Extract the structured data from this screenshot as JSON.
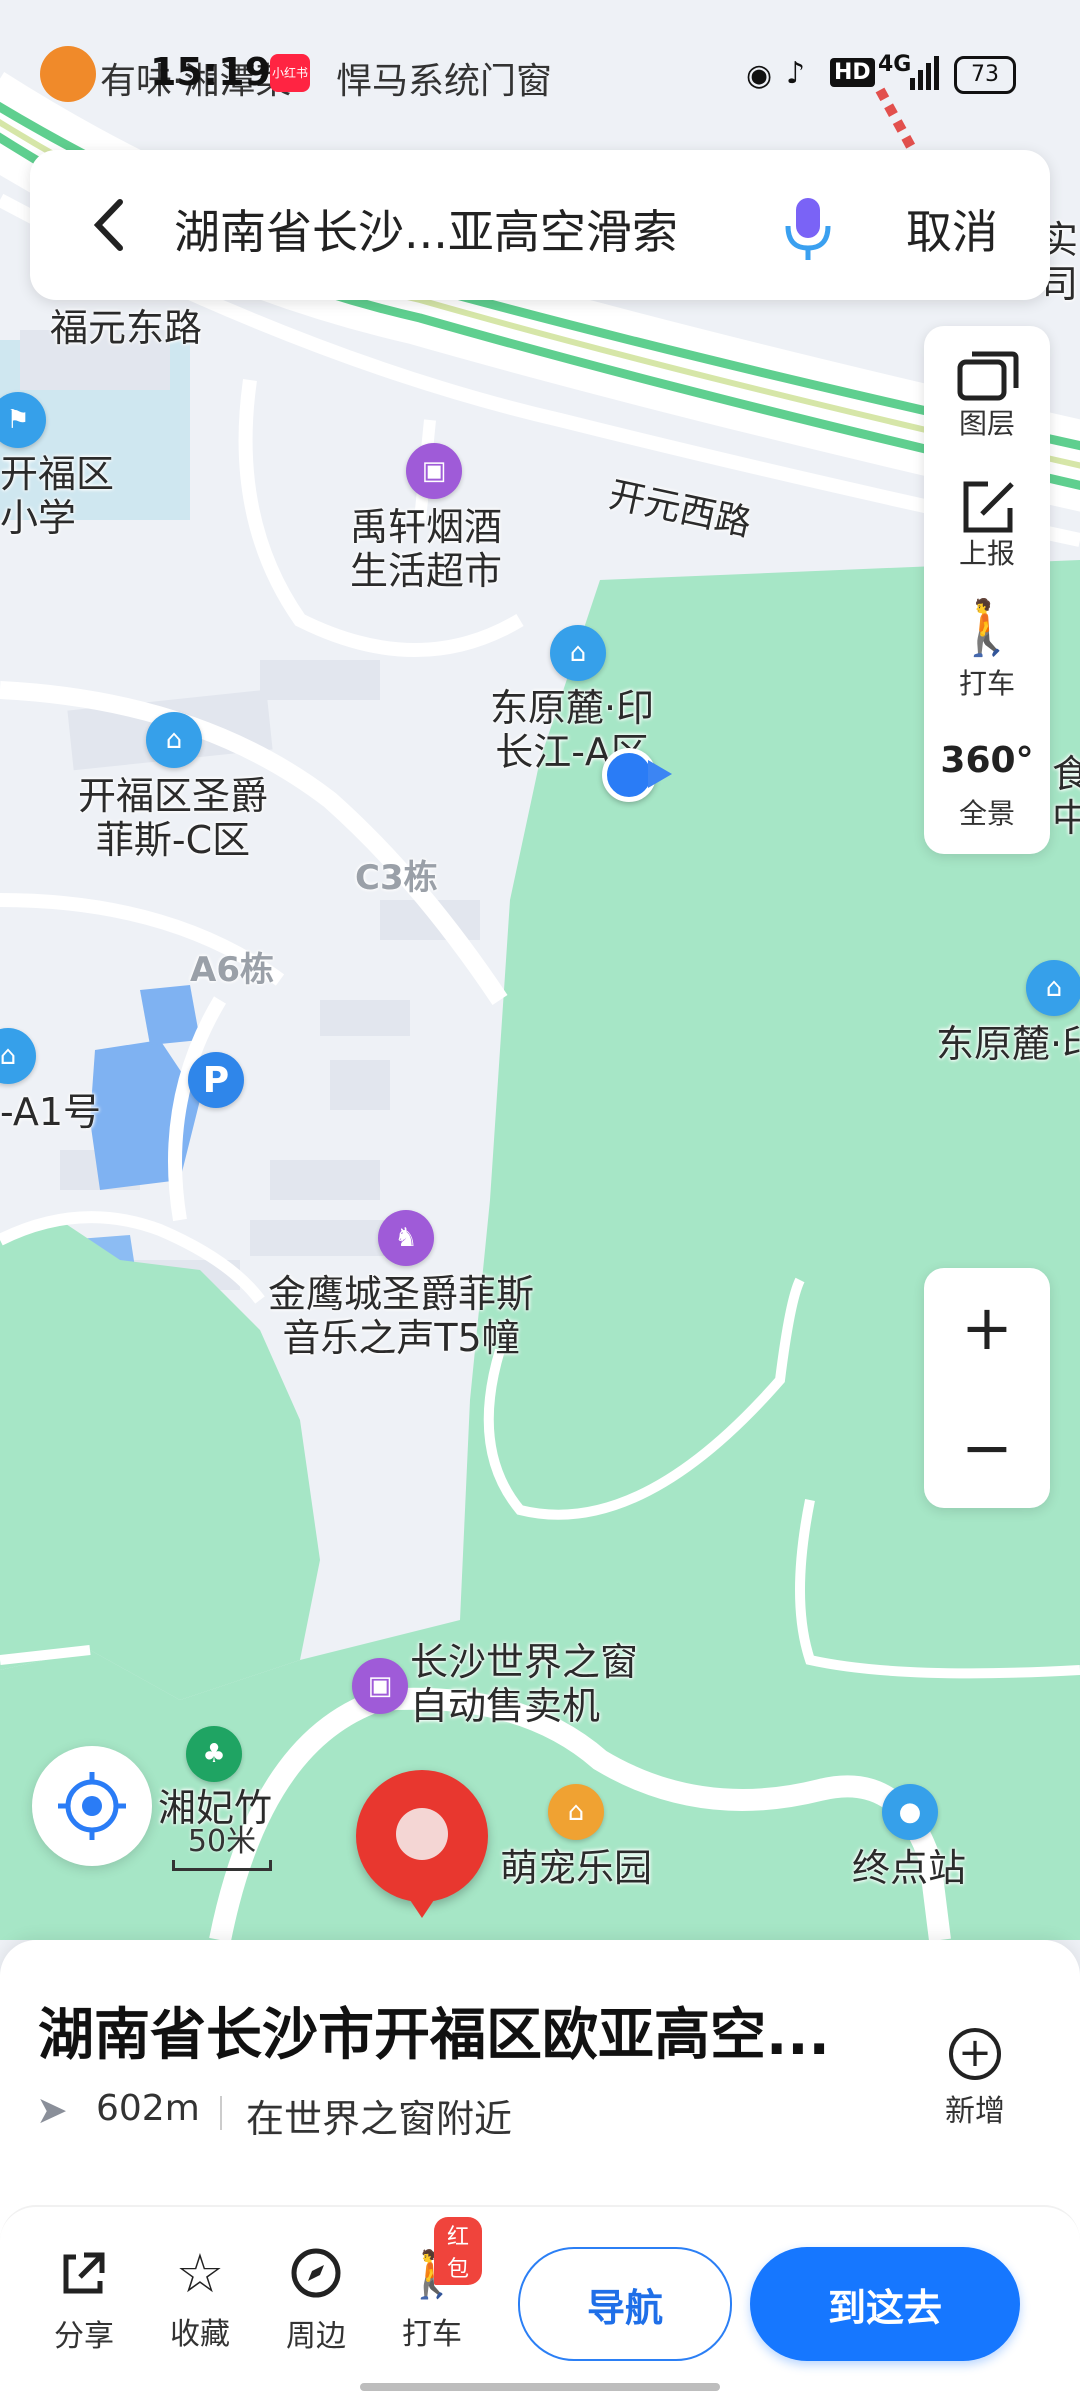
{
  "status_bar": {
    "time": "15:19",
    "notif_app_1": "有味·湘潭菜",
    "notif_app_2": "小红书",
    "notif_text": "悍马系统门窗",
    "network": "4G",
    "hd": "HD",
    "battery": "73"
  },
  "search": {
    "query": "湖南省长沙...亚高空滑索",
    "cancel_label": "取消"
  },
  "tools": [
    {
      "label": "图层",
      "icon": "layers-icon"
    },
    {
      "label": "上报",
      "icon": "report-edit-icon"
    },
    {
      "label": "打车",
      "icon": "taxi-icon"
    },
    {
      "label": "全景",
      "icon": "panorama-360-icon",
      "icon_text": "360°"
    }
  ],
  "zoom": {
    "in": "+",
    "out": "−"
  },
  "map": {
    "roads": {
      "kaiyuan": "开元西路",
      "fuyuan": "福元东路"
    },
    "pois": {
      "kaifu_school": "开福区\n小学",
      "yuxuan": "禹轩烟酒\n生活超市",
      "dongyuan_a": "东原麓·印\n长江-A区",
      "kaifu_sj": "开福区圣爵\n菲斯-C区",
      "c3": "C3栋",
      "a6": "A6栋",
      "a1": "-A1号",
      "jinying": "金鹰城圣爵菲斯\n音乐之声T5幢",
      "dongyuan_right": "东原麓·印",
      "right_top_1": "实",
      "right_top_2": "司",
      "right_mid": "食\n中",
      "vending": "长沙世界之窗\n自动售卖机",
      "xiangfei": "湘妃竹",
      "mengchong": "萌宠乐园",
      "terminal": "终点站"
    },
    "scale": "50米",
    "colors": {
      "park": "#a6e6c6",
      "road": "#ffffff",
      "block": "#e2e6ee",
      "water": "#7fb2f2",
      "highway": "#5fcf8f"
    }
  },
  "place": {
    "title": "湖南省长沙市开福区欧亚高空...",
    "distance": "602m",
    "near": "在世界之窗附近",
    "add_label": "新增"
  },
  "bottom": {
    "share": "分享",
    "favorite": "收藏",
    "nearby": "周边",
    "taxi": "打车",
    "taxi_badge": "红包",
    "navigate": "导航",
    "go_here": "到这去"
  }
}
